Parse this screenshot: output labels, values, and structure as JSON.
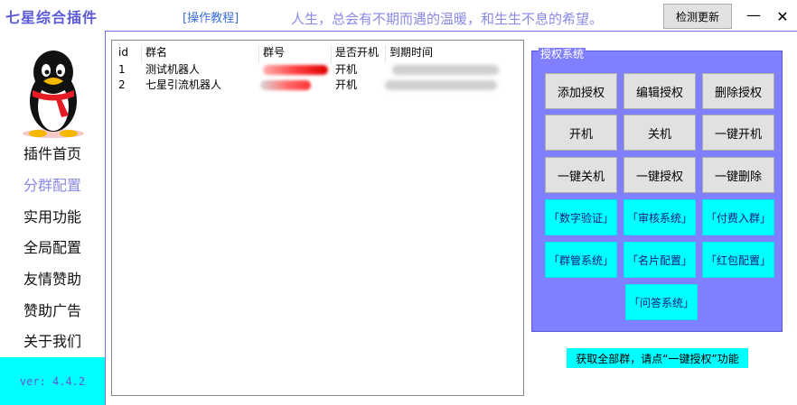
{
  "header": {
    "app_title": "七星综合插件",
    "tutorial_link": "[操作教程]",
    "slogan": "人生，总会有不期而遇的温暖，和生生不息的希望。",
    "check_update": "检测更新",
    "minimize": "—",
    "close": "✕"
  },
  "sidebar": {
    "items": [
      {
        "label": "插件首页"
      },
      {
        "label": "分群配置"
      },
      {
        "label": "实用功能"
      },
      {
        "label": "全局配置"
      },
      {
        "label": "友情赞助"
      },
      {
        "label": "赞助广告"
      },
      {
        "label": "关于我们"
      }
    ],
    "active": "分群配置",
    "version": "ver: 4.4.2"
  },
  "table": {
    "columns": [
      "id",
      "群名",
      "群号",
      "是否开机",
      "到期时间"
    ],
    "rows": [
      {
        "id": "1",
        "name": "测试机器人",
        "status": "开机"
      },
      {
        "id": "2",
        "name": "七星引流机器人",
        "status": "开机"
      }
    ]
  },
  "auth": {
    "legend": "授权系统",
    "buttons": [
      {
        "label": "添加授权"
      },
      {
        "label": "编辑授权"
      },
      {
        "label": "删除授权"
      },
      {
        "label": "开机"
      },
      {
        "label": "关机"
      },
      {
        "label": "一键开机"
      },
      {
        "label": "一键关机"
      },
      {
        "label": "一键授权"
      },
      {
        "label": "一键删除"
      }
    ],
    "feature_buttons": [
      {
        "label": "「数字验证」"
      },
      {
        "label": "「审核系统」"
      },
      {
        "label": "「付费入群」"
      },
      {
        "label": "「群管系统」"
      },
      {
        "label": "「名片配置」"
      },
      {
        "label": "「红包配置」"
      },
      {
        "label": "「问答系统」"
      }
    ]
  },
  "hint": "获取全部群，请点“一键授权”功能",
  "colors": {
    "accent": "#8080ff",
    "cyan": "#00ffff",
    "title": "#5b5bd6"
  }
}
